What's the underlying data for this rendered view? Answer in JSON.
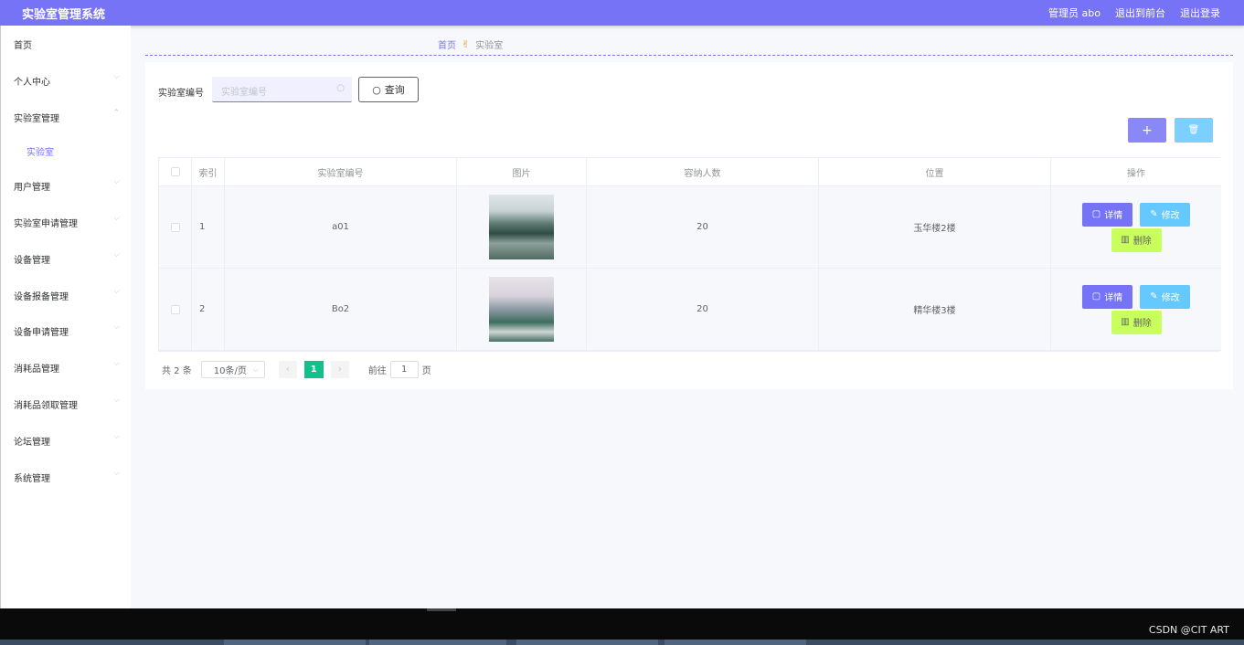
{
  "app": {
    "title": "实验室管理系统",
    "header_links": [
      "管理员 abo",
      "退出到前台",
      "退出登录"
    ]
  },
  "sidebar": {
    "items": [
      {
        "label": "首页",
        "expandable": false
      },
      {
        "label": "个人中心",
        "expandable": true
      },
      {
        "label": "实验室管理",
        "expandable": true,
        "expanded": true
      },
      {
        "label": "用户管理",
        "expandable": true
      },
      {
        "label": "实验室申请管理",
        "expandable": true
      },
      {
        "label": "设备管理",
        "expandable": true
      },
      {
        "label": "设备报备管理",
        "expandable": true
      },
      {
        "label": "设备申请管理",
        "expandable": true
      },
      {
        "label": "消耗品管理",
        "expandable": true
      },
      {
        "label": "消耗品领取管理",
        "expandable": true
      },
      {
        "label": "论坛管理",
        "expandable": true
      },
      {
        "label": "系统管理",
        "expandable": true
      }
    ],
    "subitem": "实验室"
  },
  "breadcrumb": {
    "home": "首页",
    "current": "实验室"
  },
  "search": {
    "label": "实验室编号",
    "placeholder": "实验室编号",
    "button": "查询"
  },
  "table": {
    "headers": [
      "索引",
      "实验室编号",
      "图片",
      "容纳人数",
      "位置",
      "操作"
    ],
    "rows": [
      {
        "index": "1",
        "code": "a01",
        "capacity": "20",
        "location": "玉华楼2楼"
      },
      {
        "index": "2",
        "code": "Bo2",
        "capacity": "20",
        "location": "精华楼3楼"
      }
    ],
    "actions": {
      "detail": "详情",
      "edit": "修改",
      "delete": "删除"
    }
  },
  "pagination": {
    "total": "共 2 条",
    "page_size": "10条/页",
    "current_page": "1",
    "goto_label": "前往",
    "goto_value": "1",
    "page_suffix": "页"
  },
  "taskbar": {
    "watermark": "CSDN @CIT ART"
  },
  "colors": {
    "primary": "#7673f6",
    "info": "#65c8ff",
    "danger": "#c9ff5c",
    "success": "#13c08b"
  }
}
